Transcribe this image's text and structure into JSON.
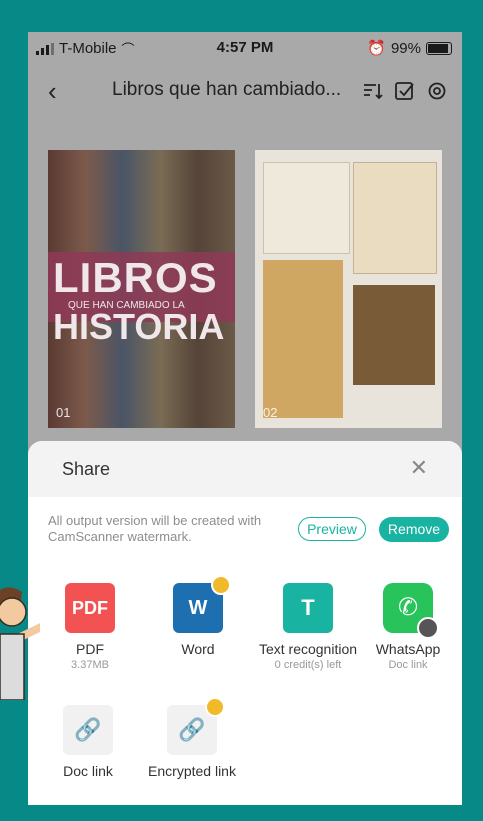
{
  "status_bar": {
    "carrier": "T-Mobile",
    "time": "4:57 PM",
    "battery": "99%"
  },
  "nav": {
    "title": "Libros que han cambiado..."
  },
  "thumbnails": [
    {
      "page": "01",
      "lines": [
        "LIBROS",
        "QUE HAN CAMBIADO LA",
        "HISTORIA"
      ]
    },
    {
      "page": "02"
    }
  ],
  "share": {
    "title": "Share",
    "notice": "All output version will be created with CamScanner watermark.",
    "preview_label": "Preview",
    "remove_label": "Remove",
    "options": [
      {
        "label": "PDF",
        "sub": "3.37MB",
        "icon": "pdf-icon",
        "icon_text": "PDF",
        "color": "#f35252"
      },
      {
        "label": "Word",
        "sub": "",
        "icon": "word-icon",
        "icon_text": "W",
        "color": "#1d6fb0"
      },
      {
        "label": "Text recognition",
        "sub": "0 credit(s) left",
        "icon": "text-recognition-icon",
        "icon_text": "T",
        "color": "#19b3a1"
      },
      {
        "label": "WhatsApp",
        "sub": "Doc link",
        "icon": "whatsapp-icon",
        "icon_text": "✆",
        "color": "#28c35a"
      },
      {
        "label": "Doc link",
        "sub": "",
        "icon": "link-icon",
        "icon_text": "🔗",
        "color": "#f1f1f1"
      },
      {
        "label": "Encrypted link",
        "sub": "",
        "icon": "encrypted-link-icon",
        "icon_text": "🔗",
        "color": "#f1f1f1"
      }
    ]
  },
  "colors": {
    "accent": "#19b3a1",
    "frame": "#078a87"
  }
}
